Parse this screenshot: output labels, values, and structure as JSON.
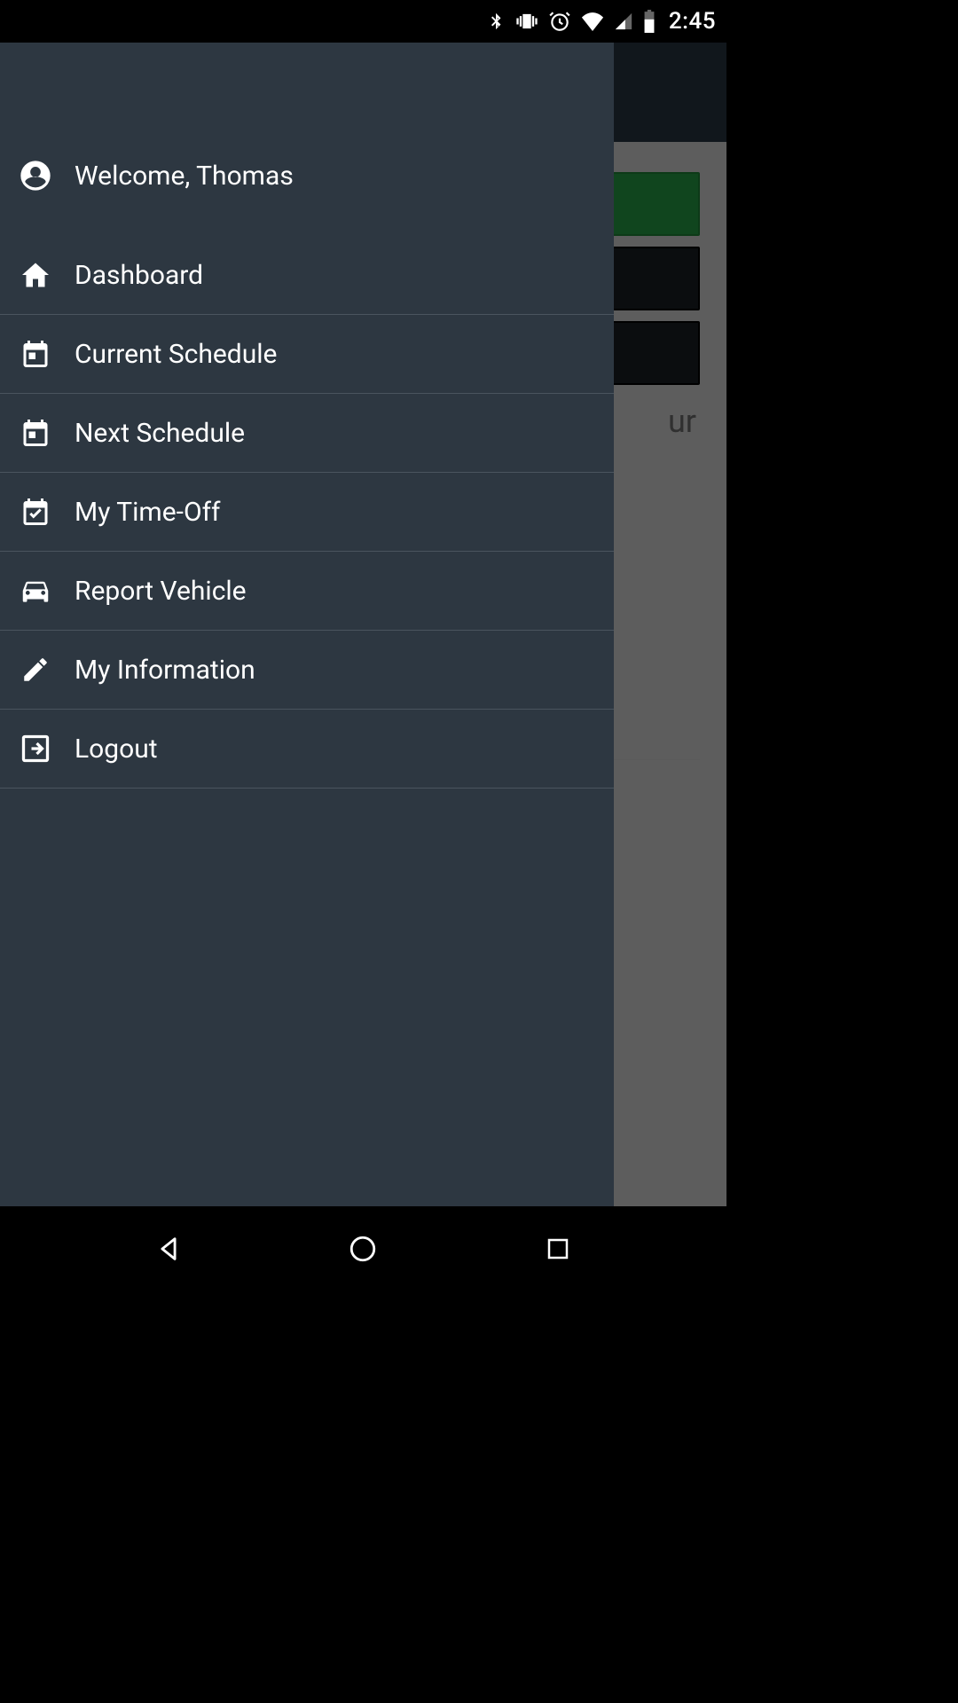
{
  "status_bar": {
    "time": "2:45"
  },
  "drawer": {
    "welcome_label": "Welcome, Thomas",
    "items": [
      {
        "label": "Dashboard"
      },
      {
        "label": "Current Schedule"
      },
      {
        "label": "Next Schedule"
      },
      {
        "label": "My Time-Off"
      },
      {
        "label": "Report Vehicle"
      },
      {
        "label": "My Information"
      },
      {
        "label": "Logout"
      }
    ]
  },
  "background": {
    "peek_text": "ur"
  }
}
